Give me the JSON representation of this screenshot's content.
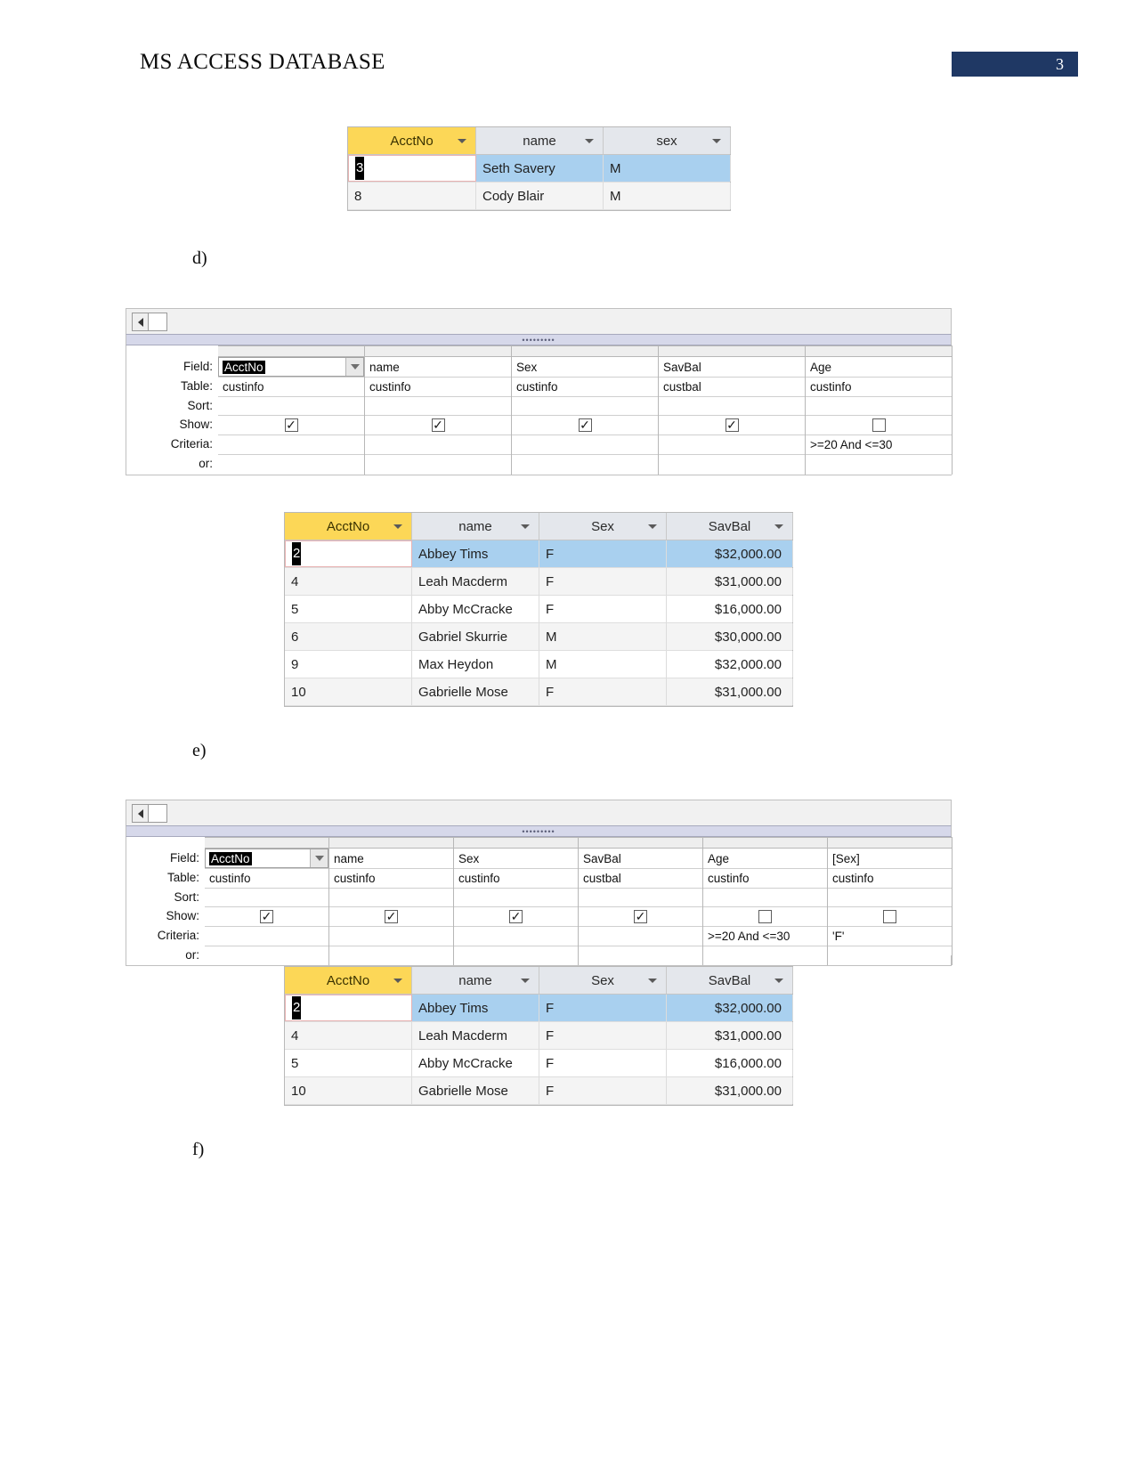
{
  "header": {
    "title": "MS ACCESS DATABASE",
    "page_number": "3",
    "accent_color": "#1f3864"
  },
  "list_letters": {
    "d": "d)",
    "e": "e)",
    "f": "f)"
  },
  "datasheet_top": {
    "columns": [
      "AcctNo",
      "name",
      "sex"
    ],
    "rows": [
      {
        "AcctNo": "3",
        "name": "Seth Savery",
        "sex": "M",
        "selected": true,
        "editing": true
      },
      {
        "AcctNo": "8",
        "name": "Cody Blair",
        "sex": "M",
        "selected": false,
        "editing": false
      }
    ]
  },
  "query_grid_d": {
    "row_labels": [
      "Field:",
      "Table:",
      "Sort:",
      "Show:",
      "Criteria:",
      "or:"
    ],
    "columns": [
      {
        "field": "AcctNo",
        "table": "custinfo",
        "sort": "",
        "show": true,
        "criteria": "",
        "or": "",
        "selected_field": true
      },
      {
        "field": "name",
        "table": "custinfo",
        "sort": "",
        "show": true,
        "criteria": "",
        "or": ""
      },
      {
        "field": "Sex",
        "table": "custinfo",
        "sort": "",
        "show": true,
        "criteria": "",
        "or": ""
      },
      {
        "field": "SavBal",
        "table": "custbal",
        "sort": "",
        "show": true,
        "criteria": "",
        "or": ""
      },
      {
        "field": "Age",
        "table": "custinfo",
        "sort": "",
        "show": false,
        "criteria": ">=20 And <=30",
        "or": ""
      }
    ]
  },
  "datasheet_e": {
    "columns": [
      "AcctNo",
      "name",
      "Sex",
      "SavBal"
    ],
    "rows": [
      {
        "AcctNo": "2",
        "name": "Abbey Tims",
        "Sex": "F",
        "SavBal": "$32,000.00",
        "selected": true,
        "editing": true
      },
      {
        "AcctNo": "4",
        "name": "Leah Macderm",
        "Sex": "F",
        "SavBal": "$31,000.00",
        "selected": false,
        "editing": false
      },
      {
        "AcctNo": "5",
        "name": "Abby McCracke",
        "Sex": "F",
        "SavBal": "$16,000.00",
        "selected": false,
        "editing": false
      },
      {
        "AcctNo": "6",
        "name": "Gabriel Skurrie",
        "Sex": "M",
        "SavBal": "$30,000.00",
        "selected": false,
        "editing": false
      },
      {
        "AcctNo": "9",
        "name": "Max Heydon",
        "Sex": "M",
        "SavBal": "$32,000.00",
        "selected": false,
        "editing": false
      },
      {
        "AcctNo": "10",
        "name": "Gabrielle Mose",
        "Sex": "F",
        "SavBal": "$31,000.00",
        "selected": false,
        "editing": false
      }
    ]
  },
  "query_grid_e": {
    "row_labels": [
      "Field:",
      "Table:",
      "Sort:",
      "Show:",
      "Criteria:",
      "or:"
    ],
    "columns": [
      {
        "field": "AcctNo",
        "table": "custinfo",
        "sort": "",
        "show": true,
        "criteria": "",
        "or": "",
        "selected_field": true
      },
      {
        "field": "name",
        "table": "custinfo",
        "sort": "",
        "show": true,
        "criteria": "",
        "or": ""
      },
      {
        "field": "Sex",
        "table": "custinfo",
        "sort": "",
        "show": true,
        "criteria": "",
        "or": ""
      },
      {
        "field": "SavBal",
        "table": "custbal",
        "sort": "",
        "show": true,
        "criteria": "",
        "or": ""
      },
      {
        "field": "Age",
        "table": "custinfo",
        "sort": "",
        "show": false,
        "criteria": ">=20 And <=30",
        "or": ""
      },
      {
        "field": "[Sex]",
        "table": "custinfo",
        "sort": "",
        "show": false,
        "criteria": "'F'",
        "or": ""
      }
    ]
  },
  "datasheet_f": {
    "columns": [
      "AcctNo",
      "name",
      "Sex",
      "SavBal"
    ],
    "rows": [
      {
        "AcctNo": "2",
        "name": "Abbey Tims",
        "Sex": "F",
        "SavBal": "$32,000.00",
        "selected": true,
        "editing": true
      },
      {
        "AcctNo": "4",
        "name": "Leah Macderm",
        "Sex": "F",
        "SavBal": "$31,000.00",
        "selected": false,
        "editing": false
      },
      {
        "AcctNo": "5",
        "name": "Abby McCracke",
        "Sex": "F",
        "SavBal": "$16,000.00",
        "selected": false,
        "editing": false
      },
      {
        "AcctNo": "10",
        "name": "Gabrielle Mose",
        "Sex": "F",
        "SavBal": "$31,000.00",
        "selected": false,
        "editing": false
      }
    ]
  },
  "icons": {
    "dropdown_caret": "caret-down-icon",
    "checkbox_checked": "✓",
    "nav_prev": "triangle-left-icon"
  }
}
